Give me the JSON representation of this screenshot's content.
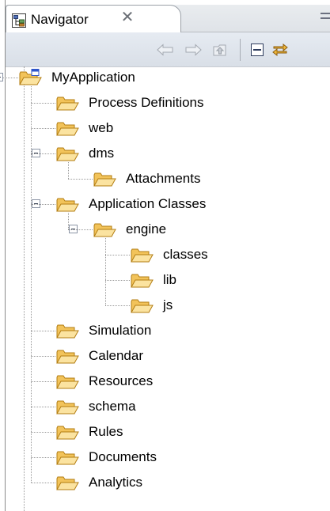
{
  "view": {
    "tab_label": "Navigator",
    "tab_icon": "navigator-view-icon",
    "close_glyph": "✕"
  },
  "toolbar": {
    "buttons": [
      "back-arrow-icon",
      "forward-arrow-icon",
      "up-level-icon",
      "collapse-all-icon",
      "link-with-editor-icon"
    ]
  },
  "tree": {
    "root": "MyApplication",
    "items": [
      {
        "label": "Process Definitions"
      },
      {
        "label": "web"
      },
      {
        "label": "dms",
        "children": [
          {
            "label": "Attachments"
          }
        ]
      },
      {
        "label": "Application Classes",
        "children": [
          {
            "label": "engine",
            "children": [
              {
                "label": "classes"
              },
              {
                "label": "lib"
              },
              {
                "label": "js"
              }
            ]
          }
        ]
      },
      {
        "label": "Simulation"
      },
      {
        "label": "Calendar"
      },
      {
        "label": "Resources"
      },
      {
        "label": "schema"
      },
      {
        "label": "Rules"
      },
      {
        "label": "Documents"
      },
      {
        "label": "Analytics"
      }
    ]
  },
  "colors": {
    "folder_fill": "#f2c35a",
    "folder_edge": "#b37d12",
    "project_blue": "#2f55c9"
  }
}
